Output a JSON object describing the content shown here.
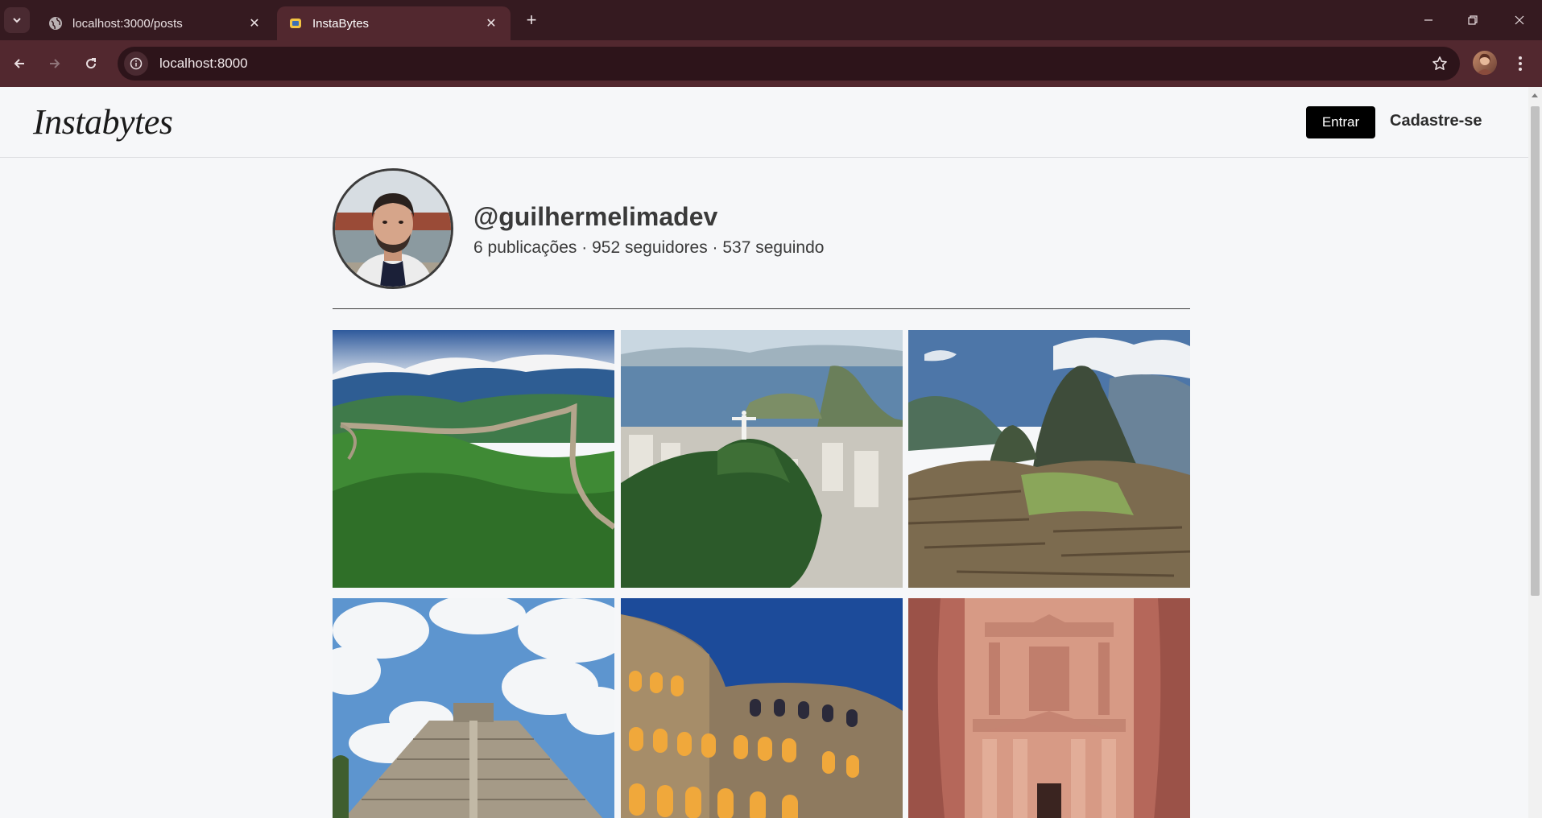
{
  "browser": {
    "tabs": [
      {
        "title": "localhost:3000/posts",
        "active": false
      },
      {
        "title": "InstaBytes",
        "active": true
      }
    ],
    "url": "localhost:8000"
  },
  "header": {
    "logo": "Instabytes",
    "login_label": "Entrar",
    "signup_label": "Cadastre-se"
  },
  "profile": {
    "username": "@guilhermelimadev",
    "stats": "6 publicações · 952 seguidores · 537 seguindo"
  },
  "posts": [
    {
      "subject": "Great Wall of China"
    },
    {
      "subject": "Christ the Redeemer, Rio de Janeiro"
    },
    {
      "subject": "Machu Picchu"
    },
    {
      "subject": "Chichén Itzá"
    },
    {
      "subject": "Colosseum"
    },
    {
      "subject": "Petra"
    }
  ],
  "colors": {
    "tabstrip": "#351a20",
    "toolbar": "#52282f",
    "page_bg": "#f6f7f9",
    "primary_button": "#000000"
  }
}
